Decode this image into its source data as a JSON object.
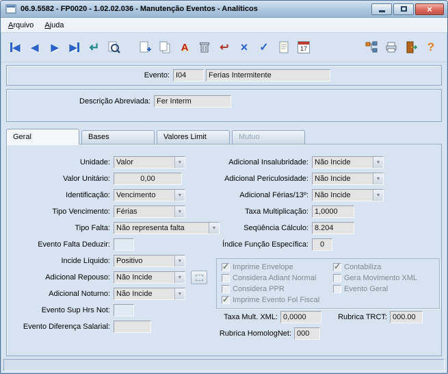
{
  "window": {
    "title": "06.9.5582 - FP0020 - 1.02.02.036 - Manutenção Eventos - Analíticos"
  },
  "colors": {
    "titlebar_blue": "#a9c4dd",
    "close_button_red": "#d9695b",
    "accent_blue": "#2b62c9",
    "window_bg": "#d7e3f0",
    "field_gray": "#e4e4e4"
  },
  "menu": {
    "arquivo": "Arquivo",
    "ajuda": "Ajuda"
  },
  "toolbar": {
    "calendar_day": "17",
    "icons": [
      "first-record",
      "prev-record",
      "next-record",
      "last-record",
      "go-to",
      "search",
      "add-document",
      "copy-document",
      "font",
      "delete",
      "undo",
      "cancel",
      "confirm",
      "notes",
      "calendar",
      "related-features",
      "print",
      "exit",
      "help"
    ]
  },
  "header": {
    "evento": {
      "label": "Evento:",
      "code": "I04",
      "description": "Ferias Intermitente"
    },
    "descricao_abreviada": {
      "label": "Descrição Abreviada:",
      "value": "Fer Interm"
    }
  },
  "tabs": {
    "geral": "Geral",
    "bases": "Bases",
    "valores_limit": "Valores Limit",
    "mutuo": "Mutuo"
  },
  "form": {
    "unidade": {
      "label": "Unidade:",
      "value": "Valor"
    },
    "valor_unitario": {
      "label": "Valor Unitário:",
      "value": "0,00"
    },
    "identificacao": {
      "label": "Identificação:",
      "value": "Vencimento"
    },
    "tipo_vencimento": {
      "label": "Tipo Vencimento:",
      "value": "Férias"
    },
    "tipo_falta": {
      "label": "Tipo Falta:",
      "value": "Não representa falta"
    },
    "evento_falta_deduzir": {
      "label": "Evento Falta Deduzir:",
      "value": ""
    },
    "incide_liquido": {
      "label": "Incide Líquido:",
      "value": "Positivo"
    },
    "adicional_repouso": {
      "label": "Adicional Repouso:",
      "value": "Não Incide"
    },
    "adicional_noturno": {
      "label": "Adicional Noturno:",
      "value": "Não Incide"
    },
    "evento_sup_hrs_not": {
      "label": "Evento Sup Hrs Not:",
      "value": ""
    },
    "evento_diferenca_salarial": {
      "label": "Evento Diferença Salarial:",
      "value": ""
    },
    "adicional_insalubridade": {
      "label": "Adicional Insalubridade:",
      "value": "Não Incide"
    },
    "adicional_periculosidade": {
      "label": "Adicional Periculosidade:",
      "value": "Não Incide"
    },
    "adicional_ferias_13": {
      "label": "Adicional Férias/13º:",
      "value": "Não Incide"
    },
    "taxa_multiplicacao": {
      "label": "Taxa Multiplicação:",
      "value": "1,0000"
    },
    "sequencia_calculo": {
      "label": "Seqüência Cálculo:",
      "value": "8.204"
    },
    "indice_funcao_especifica": {
      "label": "Índice Função Específica:",
      "value": "0"
    },
    "taxa_mult_xml": {
      "label": "Taxa Mult. XML:",
      "value": "0,0000"
    },
    "rubrica_trct": {
      "label": "Rubrica TRCT:",
      "value": "000.00"
    },
    "rubrica_homolognet": {
      "label": "Rubrica HomologNet:",
      "value": "000"
    }
  },
  "checkboxes": {
    "imprime_envelope": {
      "label": "Imprime Envelope",
      "checked": true
    },
    "considera_adiant_normal": {
      "label": "Considera Adiant Normal",
      "checked": false
    },
    "considera_ppr": {
      "label": "Considera PPR",
      "checked": false
    },
    "imprime_evento_fol_fiscal": {
      "label": "Imprime Evento Fol Fiscal",
      "checked": true
    },
    "contabiliza": {
      "label": "Contabiliza",
      "checked": true
    },
    "gera_movimento_xml": {
      "label": "Gera Movimento XML",
      "checked": false
    },
    "evento_geral": {
      "label": "Evento Geral",
      "checked": false
    }
  }
}
